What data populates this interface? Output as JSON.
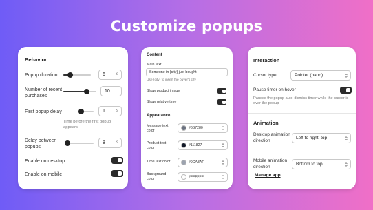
{
  "title": "Customize popups",
  "behavior": {
    "heading": "Behavior",
    "popup_duration": {
      "label": "Popup duration",
      "value": "6",
      "unit": "s",
      "level": 0.25
    },
    "recent_purchases": {
      "label": "Number of recent purchases",
      "value": "10",
      "level": 0.7
    },
    "first_delay": {
      "label": "First popup delay",
      "value": "1",
      "unit": "s",
      "level": 0.02,
      "help": "Time before the first popup appears"
    },
    "delay_between": {
      "label": "Delay between popups",
      "value": "8",
      "unit": "s",
      "level": 0.1
    },
    "enable_desktop": {
      "label": "Enable on desktop",
      "on": true
    },
    "enable_mobile": {
      "label": "Enable on mobile",
      "on": true
    }
  },
  "content": {
    "heading": "Content",
    "main_text_label": "Main text",
    "main_text_value": "Someone in {city} just bought",
    "main_text_help": "Use {city} to insert the buyer's city",
    "show_image_label": "Show product image",
    "show_time_label": "Show relative time",
    "appearance_heading": "Appearance",
    "message_color": {
      "label": "Message text color",
      "value": "#6B7280",
      "swatch": "#6B7280"
    },
    "product_color": {
      "label": "Product text color",
      "value": "#111827",
      "swatch": "#111827"
    },
    "time_color": {
      "label": "Time text color",
      "value": "#9CA3AF",
      "swatch": "#9CA3AF"
    },
    "bg_color": {
      "label": "Background color",
      "value": "#FFFFFF",
      "swatch": "#FFFFFF"
    }
  },
  "interaction": {
    "heading": "Interaction",
    "cursor_label": "Cursor type",
    "cursor_value": "Pointer (hand)",
    "pause_label": "Pause timer on hover",
    "pause_help": "Pauses the popup auto-dismiss timer while the cursor is over the popup",
    "animation_heading": "Animation",
    "desktop_anim_label": "Desktop animation direction",
    "desktop_anim_value": "Left to right, top",
    "mobile_anim_label": "Mobile animation direction",
    "mobile_anim_value": "Bottom to top",
    "manage_app": "Manage app"
  }
}
